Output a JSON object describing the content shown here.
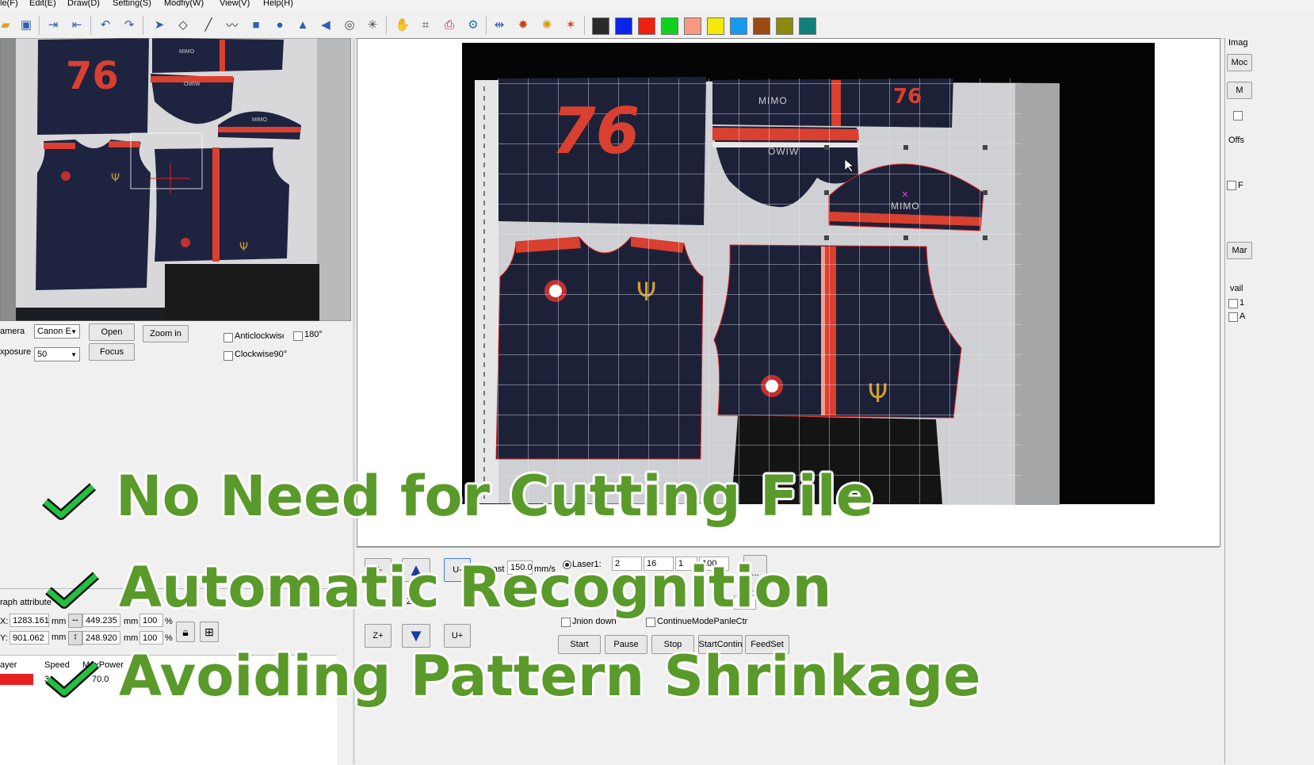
{
  "menu": [
    "le(F)",
    "Edit(E)",
    "Draw(D)",
    "Setting(S)",
    "Modfiy(W)",
    "View(V)",
    "Help(H)"
  ],
  "toolbar": {
    "icons": [
      "open-folder-icon",
      "save-icon",
      "import-icon",
      "export-icon",
      "undo-icon",
      "redo-icon",
      "select-arrow-icon",
      "node-edit-icon",
      "line-icon",
      "polyline-icon",
      "rectangle-icon",
      "circle-icon",
      "mirror-vertical-icon",
      "mirror-horizontal-icon",
      "spiral-icon",
      "star-icon",
      "hand-pan-icon",
      "crop-icon",
      "printer-icon",
      "gear-icon",
      "align-icon",
      "array-icon",
      "cluster-icon",
      "node-star-icon"
    ],
    "swatches": [
      "#2a2a2a",
      "#0a24e8",
      "#f02010",
      "#10d020",
      "#f59a80",
      "#f5e80a",
      "#1899f0",
      "#9a4a10",
      "#8a8a10",
      "#10807a"
    ]
  },
  "camera_panel": {
    "camera_label": "amera",
    "camera_value": "Canon E",
    "exposure_label": "xposure",
    "exposure_value": "50",
    "open_label": "Open",
    "focus_label": "Focus",
    "zoomin_label": "Zoom in",
    "anticlockwise_label": "Anticlockwise",
    "rotate180_label": "180°",
    "clockwise90_label": "Clockwise90°"
  },
  "thumb_text": {
    "number": "76",
    "mimo1": "MIMO",
    "mimo2": "OWIW",
    "mimo3": "MIMO"
  },
  "main_text": {
    "number": "76",
    "small_number": "76",
    "mimo1": "MIMO",
    "mimo2": "OWIW",
    "mimo3": "MIMO"
  },
  "graph_attr": {
    "title": "raph attribute",
    "x_label": "X:",
    "x_value": "1283.161",
    "y_label": "Y:",
    "y_value": "901.062",
    "unit": "mm",
    "w_value": "449.235",
    "h_value": "248.920",
    "w_pct": "100",
    "h_pct": "100",
    "pct": "%"
  },
  "layer_table": {
    "headers": [
      "ayer",
      "Speed",
      "MaxPower"
    ],
    "row": {
      "color": "#e82020",
      "speed": "3",
      "power": "70.0"
    }
  },
  "motion": {
    "z_minus": "Z-",
    "u_minus": "U-",
    "z_plus": "Z+",
    "u_plus": "U+",
    "ze_label": "Ze",
    "fast_label": "Fast",
    "fast_value": "150.0",
    "speed_unit": "mm/s",
    "laser_label": "Laser1:",
    "laser_v1": "2",
    "laser_v2": "16",
    "laser_v3": "1",
    "laser_v4": "100",
    "dots_label": "...",
    "hidden_value": "00",
    "union_label": "Jnion down",
    "continue_label": "ContinueModePanleCtr",
    "start_label": "Start",
    "pause_label": "Pause",
    "stop_label": "Stop",
    "startcont_label": "StartContin",
    "feedset_label": "FeedSet"
  },
  "right_panel": {
    "items": [
      "Imag",
      "Moc",
      "M",
      "Offs",
      "F",
      "Mar",
      "vail",
      "1",
      "A"
    ]
  },
  "overlay": {
    "line1": "No Need for Cutting File",
    "line2": "Automatic Recognition",
    "line3": "Avoiding Pattern Shrinkage"
  }
}
